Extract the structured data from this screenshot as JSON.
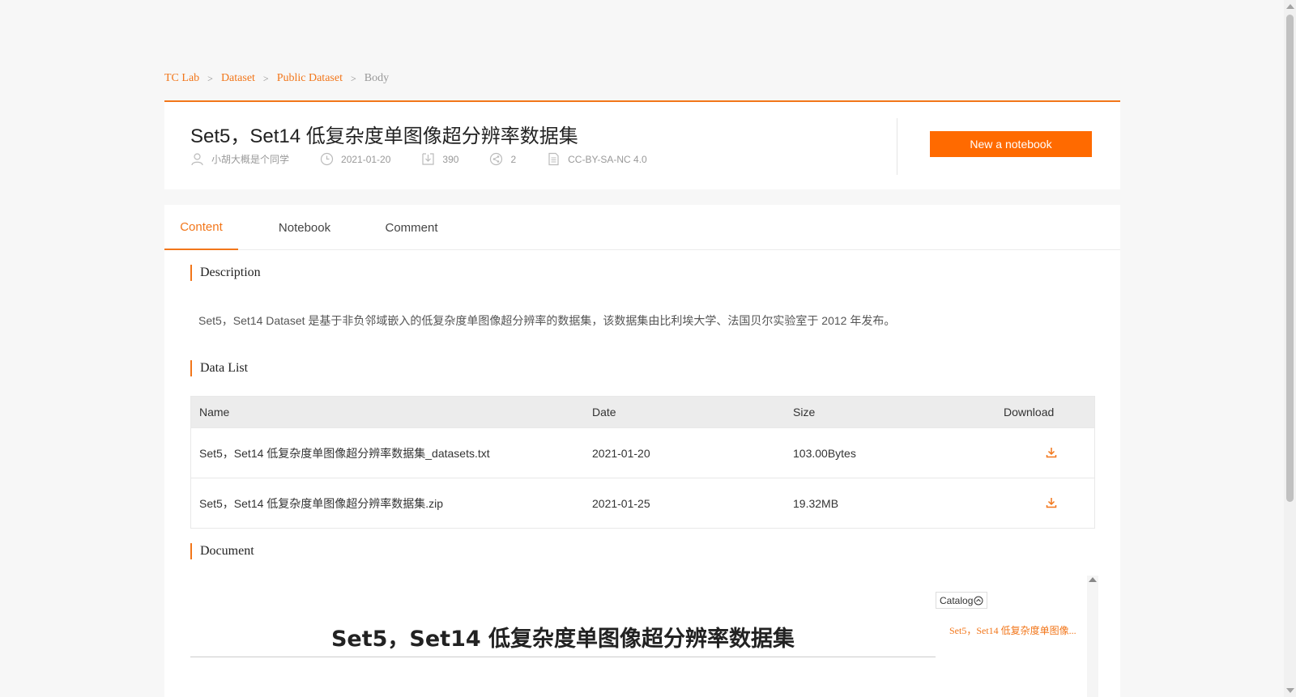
{
  "breadcrumb": [
    {
      "label": "TC Lab"
    },
    {
      "label": "Dataset"
    },
    {
      "label": "Public Dataset"
    },
    {
      "label": "Body"
    }
  ],
  "header": {
    "title": "Set5，Set14 低复杂度单图像超分辨率数据集",
    "author": "小胡大概是个同学",
    "date": "2021-01-20",
    "downloads": "390",
    "shares": "2",
    "license": "CC-BY-SA-NC 4.0",
    "new_notebook_label": "New a notebook"
  },
  "tabs": [
    {
      "label": "Content",
      "active": true
    },
    {
      "label": "Notebook",
      "active": false
    },
    {
      "label": "Comment",
      "active": false
    }
  ],
  "sections": {
    "description_title": "Description",
    "description_text": "Set5，Set14 Dataset 是基于非负邻域嵌入的低复杂度单图像超分辨率的数据集，该数据集由比利埃大学、法国贝尔实验室于 2012 年发布。",
    "data_list_title": "Data List",
    "document_title": "Document"
  },
  "table": {
    "headers": {
      "name": "Name",
      "date": "Date",
      "size": "Size",
      "download": "Download"
    },
    "rows": [
      {
        "name": "Set5，Set14 低复杂度单图像超分辨率数据集_datasets.txt",
        "date": "2021-01-20",
        "size": "103.00Bytes"
      },
      {
        "name": "Set5，Set14 低复杂度单图像超分辨率数据集.zip",
        "date": "2021-01-25",
        "size": "19.32MB"
      }
    ]
  },
  "document": {
    "heading": "Set5，Set14 低复杂度单图像超分辨率数据集",
    "catalog_label": "Catalog",
    "catalog_items": [
      "Set5，Set14 低复杂度单图像..."
    ]
  },
  "icons": {
    "author": "user-icon",
    "date": "clock-icon",
    "downloads": "download-icon",
    "shares": "share-icon",
    "license": "document-icon",
    "row_download": "download-icon",
    "catalog_toggle": "chevron-up-circle-icon"
  },
  "colors": {
    "accent": "#f2761a",
    "button": "#ff6a00"
  }
}
